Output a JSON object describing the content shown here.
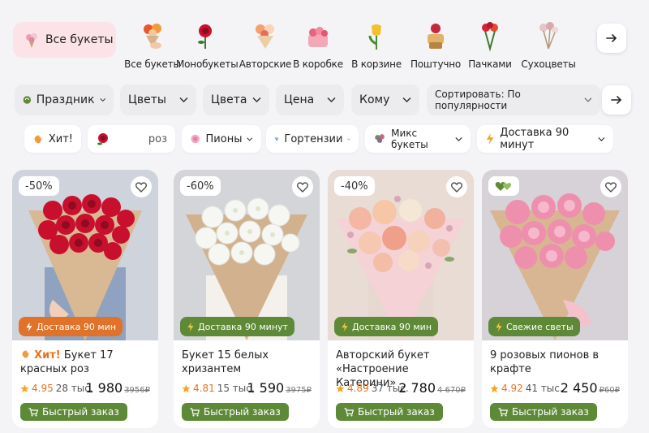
{
  "categories": {
    "all_chip": {
      "label": "Все букеты",
      "icon": "bouquet-icon"
    },
    "items": [
      {
        "label": "Все букеты",
        "icon": "bouquet-hand-icon",
        "active": true
      },
      {
        "label": "Монобукеты",
        "icon": "rose-icon"
      },
      {
        "label": "Авторские",
        "icon": "author-bouquet-icon"
      },
      {
        "label": "В коробке",
        "icon": "flower-box-icon"
      },
      {
        "label": "В корзине",
        "icon": "tulip-icon"
      },
      {
        "label": "Поштучно",
        "icon": "single-flowers-icon"
      },
      {
        "label": "Пачками",
        "icon": "bundle-icon"
      },
      {
        "label": "Сухоцветы",
        "icon": "dried-flowers-icon"
      }
    ]
  },
  "filters": [
    {
      "label": "Праздник",
      "icon": "holiday-icon"
    },
    {
      "label": "Цветы"
    },
    {
      "label": "Цвета"
    },
    {
      "label": "Цена"
    },
    {
      "label": "Кому"
    },
    {
      "label": "Сортировать: По популярности"
    }
  ],
  "chips": [
    {
      "label": "Хит!",
      "icon": "hit-hand-icon"
    },
    {
      "label": "роз",
      "icon": "rose-icon"
    },
    {
      "label": "Пионы",
      "icon": "peony-icon"
    },
    {
      "label": "Гортензии",
      "icon": "hydrangea-icon"
    },
    {
      "label": "Микс букеты",
      "icon": "mix-bouquet-icon"
    },
    {
      "label": "Доставка 90 минут",
      "icon": "lightning-icon"
    }
  ],
  "products": [
    {
      "discount": "-50%",
      "badge": "Доставка 90 мин",
      "badge_icon": "lightning-icon",
      "hit": "Хит!",
      "title": "Букет 17 красных роз",
      "rating": "4.95",
      "reviews": "28 тыс.",
      "price": "1 980",
      "old_price": "3956₽",
      "buy": "Быстрый заказ",
      "colors": {
        "flower": "#c8102e",
        "wrap": "#d9b894"
      }
    },
    {
      "discount": "-60%",
      "badge": "Доставка 90 минут",
      "badge_icon": "lightning-icon",
      "hit": "",
      "title": "Букет 15 белых хризантем",
      "rating": "4.81",
      "reviews": "15 тыс.",
      "price": "1 590",
      "old_price": "3975₽",
      "buy": "Быстрый заказ",
      "colors": {
        "flower": "#f6f6f3",
        "wrap": "#d2b28e"
      }
    },
    {
      "discount": "-40%",
      "badge": "Доставка 90 мин",
      "badge_icon": "lightning-icon",
      "hit": "",
      "title": "Авторский букет «Настроение Катерини»",
      "rating": "4.89",
      "reviews": "37 тыс.",
      "price": "2 780",
      "old_price": "4 670₽",
      "buy": "Быстрый заказ",
      "colors": {
        "flower": "#f3b7a3",
        "wrap": "#f4d2d6"
      }
    },
    {
      "discount": "",
      "badge": "Свежие светы",
      "badge_icon": "lightning-icon",
      "hit": "",
      "title": "9 розовых пионов в крафте",
      "rating": "4.92",
      "reviews": "41 тыс.",
      "price": "2 450",
      "old_price": "₽60₽",
      "buy": "Быстрый заказ",
      "colors": {
        "flower": "#ef8fae",
        "wrap": "#d8b693"
      }
    }
  ],
  "colors": {
    "accent_green": "#5e8a38",
    "star": "#f5a623",
    "chip_pink": "#fbe3e7"
  }
}
